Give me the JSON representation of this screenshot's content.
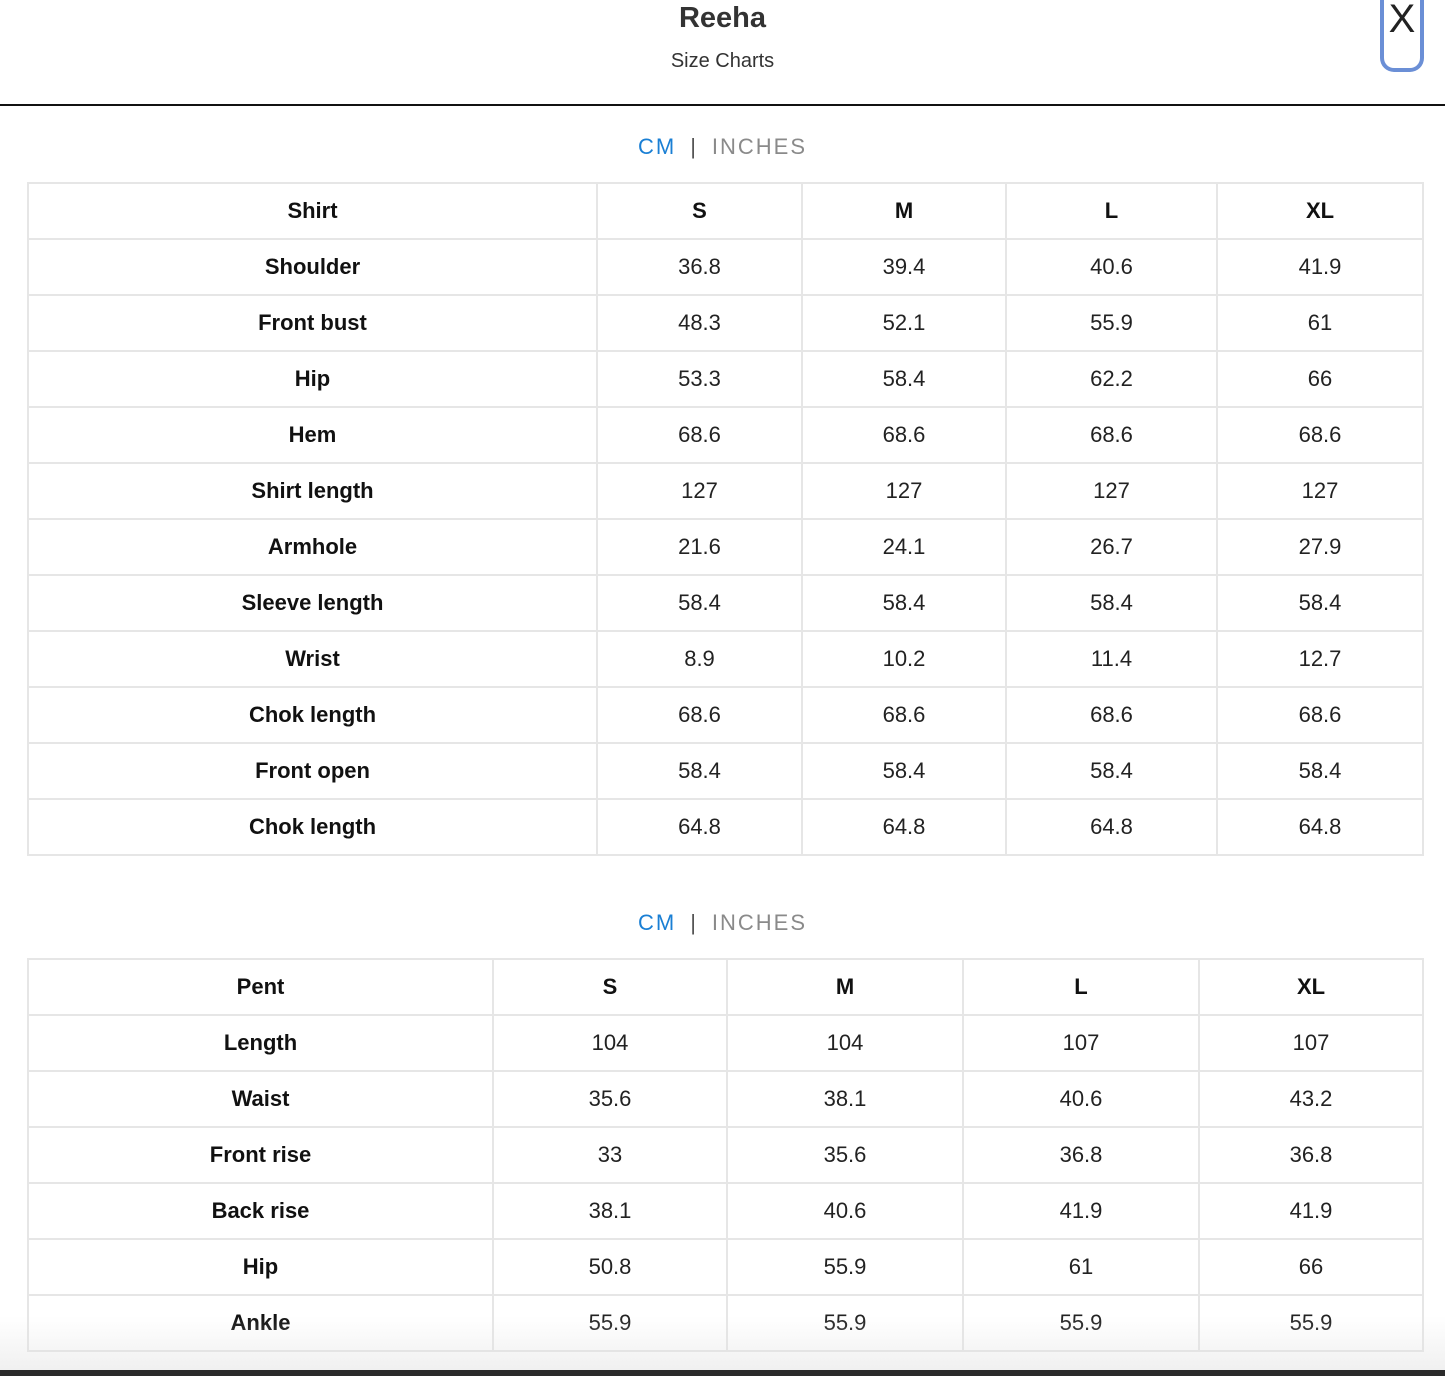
{
  "header": {
    "brand": "Reeha",
    "subtitle": "Size Charts",
    "close_label": "X"
  },
  "unit_toggle": {
    "cm": "CM",
    "separator": "|",
    "inches": "INCHES"
  },
  "shirt_table": {
    "headers": [
      "Shirt",
      "S",
      "M",
      "L",
      "XL"
    ],
    "rows": [
      {
        "label": "Shoulder",
        "values": [
          "36.8",
          "39.4",
          "40.6",
          "41.9"
        ]
      },
      {
        "label": "Front bust",
        "values": [
          "48.3",
          "52.1",
          "55.9",
          "61"
        ]
      },
      {
        "label": "Hip",
        "values": [
          "53.3",
          "58.4",
          "62.2",
          "66"
        ]
      },
      {
        "label": "Hem",
        "values": [
          "68.6",
          "68.6",
          "68.6",
          "68.6"
        ]
      },
      {
        "label": "Shirt length",
        "values": [
          "127",
          "127",
          "127",
          "127"
        ]
      },
      {
        "label": "Armhole",
        "values": [
          "21.6",
          "24.1",
          "26.7",
          "27.9"
        ]
      },
      {
        "label": "Sleeve length",
        "values": [
          "58.4",
          "58.4",
          "58.4",
          "58.4"
        ]
      },
      {
        "label": "Wrist",
        "values": [
          "8.9",
          "10.2",
          "11.4",
          "12.7"
        ]
      },
      {
        "label": "Chok length",
        "values": [
          "68.6",
          "68.6",
          "68.6",
          "68.6"
        ]
      },
      {
        "label": "Front open",
        "values": [
          "58.4",
          "58.4",
          "58.4",
          "58.4"
        ]
      },
      {
        "label": "Chok length",
        "values": [
          "64.8",
          "64.8",
          "64.8",
          "64.8"
        ]
      }
    ]
  },
  "pent_table": {
    "headers": [
      "Pent",
      "S",
      "M",
      "L",
      "XL"
    ],
    "rows": [
      {
        "label": "Length",
        "values": [
          "104",
          "104",
          "107",
          "107"
        ]
      },
      {
        "label": "Waist",
        "values": [
          "35.6",
          "38.1",
          "40.6",
          "43.2"
        ]
      },
      {
        "label": "Front rise",
        "values": [
          "33",
          "35.6",
          "36.8",
          "36.8"
        ]
      },
      {
        "label": "Back rise",
        "values": [
          "38.1",
          "40.6",
          "41.9",
          "41.9"
        ]
      },
      {
        "label": "Hip",
        "values": [
          "50.8",
          "55.9",
          "61",
          "66"
        ]
      },
      {
        "label": "Ankle",
        "values": [
          "55.9",
          "55.9",
          "55.9",
          "55.9"
        ]
      }
    ]
  }
}
